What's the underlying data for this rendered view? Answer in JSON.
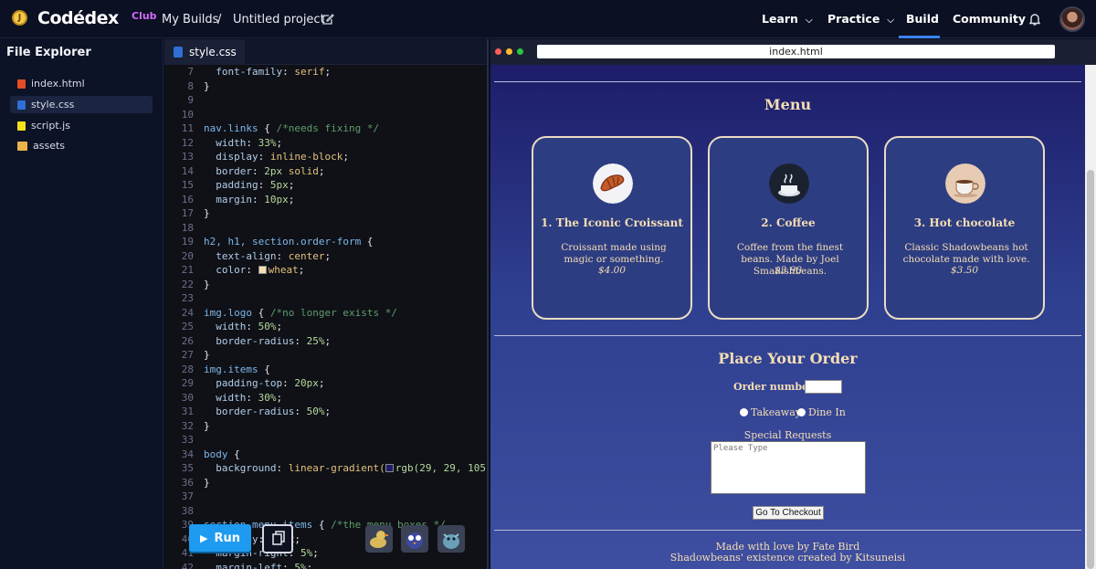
{
  "topbar": {
    "brand": "Codédex",
    "club": "Club",
    "crumb_builds": "My Builds",
    "crumb_sep": "/",
    "project": "Untitled project",
    "nav": [
      "Learn",
      "Practice",
      "Build",
      "Community"
    ],
    "accent": "#3b82f6"
  },
  "explorer": {
    "title": "File Explorer",
    "files": [
      {
        "name": "index.html",
        "icon": "html-file-icon",
        "color": "#e44d26"
      },
      {
        "name": "style.css",
        "icon": "css-file-icon",
        "color": "#2f6fd6"
      },
      {
        "name": "script.js",
        "icon": "js-file-icon",
        "color": "#f7df1e"
      },
      {
        "name": "assets",
        "icon": "folder-icon",
        "color": "#e8b34a"
      }
    ]
  },
  "editor": {
    "tab": "style.css",
    "run_label": "Run"
  },
  "preview": {
    "url": "index.html",
    "menu_title": "Menu",
    "items": [
      {
        "title": "1. The Iconic Croissant",
        "desc": "Croissant made using magic or something.",
        "price": "$4.00"
      },
      {
        "title": "2. Coffee",
        "desc": "Coffee from the finest beans. Made by Joel Smallishbeans.",
        "price": "$3.90"
      },
      {
        "title": "3. Hot chocolate",
        "desc": "Classic Shadowbeans hot chocolate made with love.",
        "price": "$3.50"
      }
    ],
    "order_title": "Place Your Order",
    "order_number_label": "Order number:",
    "takeaway": "Takeaway",
    "dine_in": "Dine In",
    "special_label": "Special Requests",
    "special_placeholder": "Please Type",
    "checkout": "Go To Checkout",
    "footer1": "Made with love by Fate Bird",
    "footer2": "Shadowbeans' existence created by Kitsuneisi"
  }
}
